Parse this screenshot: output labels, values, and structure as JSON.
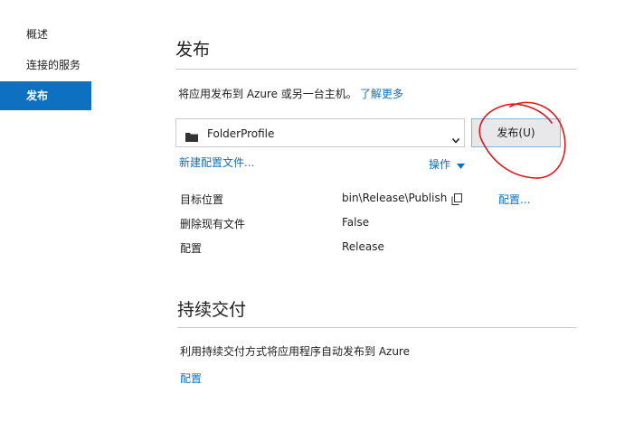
{
  "sidebar": {
    "items": [
      {
        "label": "概述"
      },
      {
        "label": "连接的服务"
      },
      {
        "label": "发布"
      }
    ]
  },
  "publish": {
    "title": "发布",
    "description": "将应用发布到 Azure 或另一台主机。",
    "learn_more": "了解更多",
    "profile_value": "FolderProfile",
    "publish_button": "发布(U)",
    "new_profile_link": "新建配置文件...",
    "actions_link": "操作",
    "details": {
      "target_label": "目标位置",
      "target_value": "bin\\Release\\Publish",
      "configure_link": "配置...",
      "delete_label": "删除现有文件",
      "delete_value": "False",
      "config_label": "配置",
      "config_value": "Release"
    }
  },
  "cd": {
    "title": "持续交付",
    "description": "利用持续交付方式将应用程序自动发布到 Azure",
    "configure_link": "配置"
  },
  "colors": {
    "accent": "#0e70c0",
    "annotation": "#e01818"
  }
}
